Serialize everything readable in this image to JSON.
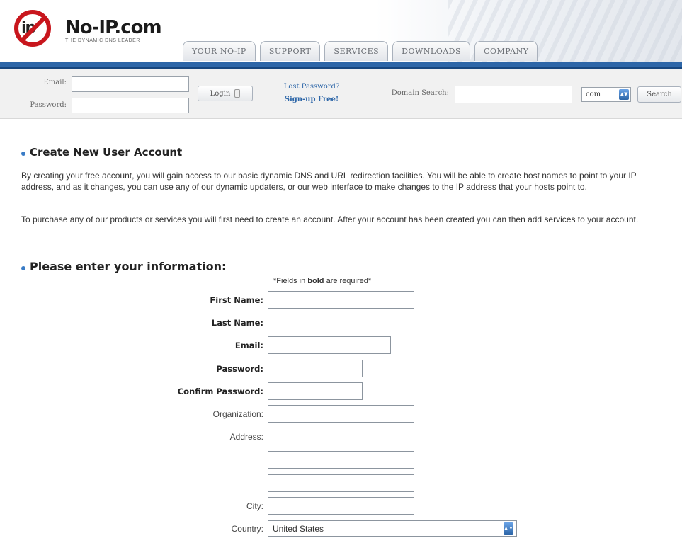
{
  "logo": {
    "name": "No-IP.com",
    "tagline": "THE DYNAMIC DNS LEADER",
    "mark": "ip"
  },
  "nav": {
    "tabs": [
      "YOUR NO-IP",
      "SUPPORT",
      "SERVICES",
      "DOWNLOADS",
      "COMPANY"
    ]
  },
  "login": {
    "email_label": "Email:",
    "password_label": "Password:",
    "login_button": "Login",
    "lost_password": "Lost Password?",
    "signup": "Sign-up Free!",
    "domain_search_label": "Domain Search:",
    "tld_selected": "com",
    "search_button": "Search"
  },
  "section1": {
    "title": "Create New User Account",
    "para1": "By creating your free account, you will gain access to our basic dynamic DNS and URL redirection facilities. You will be able to create host names to point to your IP address, and as it changes, you can use any of our dynamic updaters, or our web interface to make changes to the IP address that your hosts point to.",
    "para2": "To purchase any of our products or services you will first need to create an account. After your account has been created you can then add services to your account."
  },
  "section2": {
    "title": "Please enter your information:",
    "required_prefix": "*Fields in ",
    "required_bold": "bold",
    "required_suffix": " are required*"
  },
  "form": {
    "first_name": "First Name:",
    "last_name": "Last Name:",
    "email": "Email:",
    "password": "Password:",
    "confirm_password": "Confirm Password:",
    "organization": "Organization:",
    "address": "Address:",
    "city": "City:",
    "country": "Country:",
    "country_value": "United States"
  },
  "colors": {
    "brand_red": "#c8161d",
    "nav_blue": "#2d66a8",
    "bullet_blue": "#3a7cc6"
  }
}
